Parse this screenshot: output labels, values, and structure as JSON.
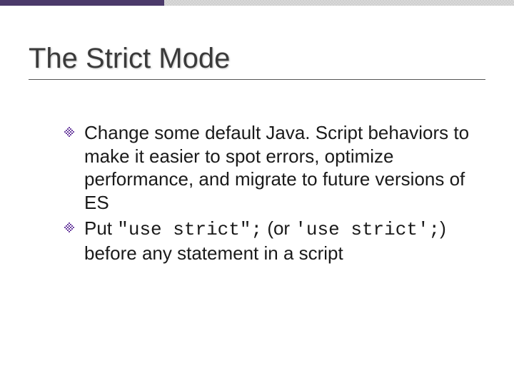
{
  "slide": {
    "title": "The Strict Mode",
    "bullets": [
      {
        "segments": [
          {
            "kind": "text",
            "value": "Change some default Java. Script behaviors to make it easier to spot errors, optimize performance, and migrate to future versions of ES"
          }
        ]
      },
      {
        "segments": [
          {
            "kind": "text",
            "value": "Put "
          },
          {
            "kind": "code",
            "value": "\"use strict\";"
          },
          {
            "kind": "text",
            "value": " (or "
          },
          {
            "kind": "code",
            "value": "'use strict';"
          },
          {
            "kind": "text",
            "value": ") before any statement in a script"
          }
        ]
      }
    ],
    "bullet_icon_color": "#6b3fa0",
    "accent_bar_color": "#4b3a6a"
  }
}
